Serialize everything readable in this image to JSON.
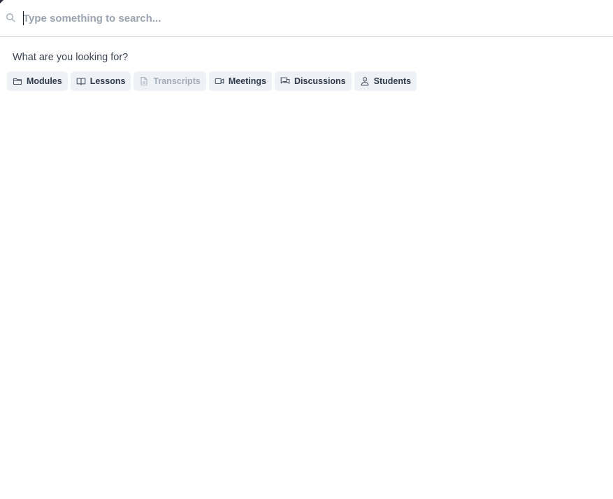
{
  "search": {
    "placeholder": "Type something to search...",
    "value": ""
  },
  "prompt_text": "What are you looking for?",
  "filters": [
    {
      "label": "Modules",
      "icon": "folder-icon",
      "enabled": true
    },
    {
      "label": "Lessons",
      "icon": "book-icon",
      "enabled": true
    },
    {
      "label": "Transcripts",
      "icon": "document-icon",
      "enabled": false
    },
    {
      "label": "Meetings",
      "icon": "video-icon",
      "enabled": true
    },
    {
      "label": "Discussions",
      "icon": "chat-icon",
      "enabled": true
    },
    {
      "label": "Students",
      "icon": "user-icon",
      "enabled": true
    }
  ],
  "colors": {
    "chip_bg": "#eef1f5",
    "chip_text": "#2f3a4b",
    "chip_disabled_text": "#a2abb8",
    "placeholder": "#9aa4b2",
    "divider": "#cfd5de"
  }
}
